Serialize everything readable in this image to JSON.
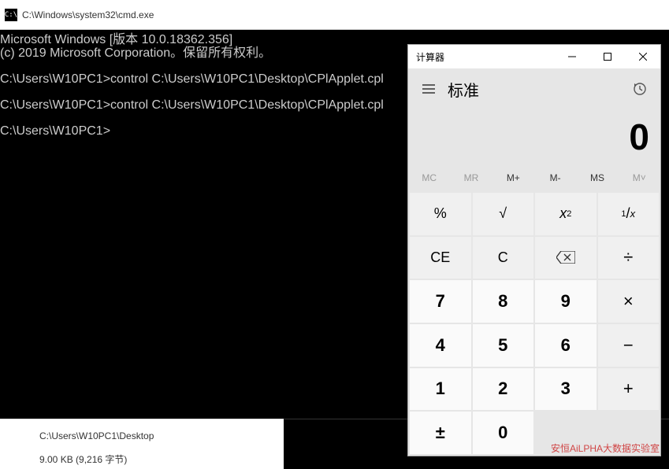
{
  "cmd": {
    "title": "C:\\Windows\\system32\\cmd.exe",
    "icon_text": "C:\\",
    "line1": "Microsoft Windows [版本 10.0.18362.356]",
    "line2": "(c) 2019 Microsoft Corporation。保留所有权利。",
    "line3": "C:\\Users\\W10PC1>control C:\\Users\\W10PC1\\Desktop\\CPlApplet.cpl",
    "line4": "C:\\Users\\W10PC1>control C:\\Users\\W10PC1\\Desktop\\CPlApplet.cpl",
    "line5": "C:\\Users\\W10PC1>"
  },
  "explorer": {
    "path": "C:\\Users\\W10PC1\\Desktop",
    "size": "9.00 KB (9,216 字节)"
  },
  "calc": {
    "title": "计算器",
    "mode": "标准",
    "display": "0",
    "memory": {
      "mc": "MC",
      "mr": "MR",
      "mplus": "M+",
      "mminus": "M-",
      "ms": "MS",
      "mv": "M˅"
    },
    "keys": {
      "percent": "%",
      "sqrt": "√",
      "sq_base": "x",
      "sq_sup": "2",
      "recip_sup": "1",
      "recip_sub": "x",
      "ce": "CE",
      "c": "C",
      "div": "÷",
      "7": "7",
      "8": "8",
      "9": "9",
      "mul": "×",
      "4": "4",
      "5": "5",
      "6": "6",
      "sub": "−",
      "1": "1",
      "2": "2",
      "3": "3",
      "add": "+",
      "neg": "±",
      "0": "0"
    }
  },
  "watermark": "安恒AiLPHA大数据实验室"
}
